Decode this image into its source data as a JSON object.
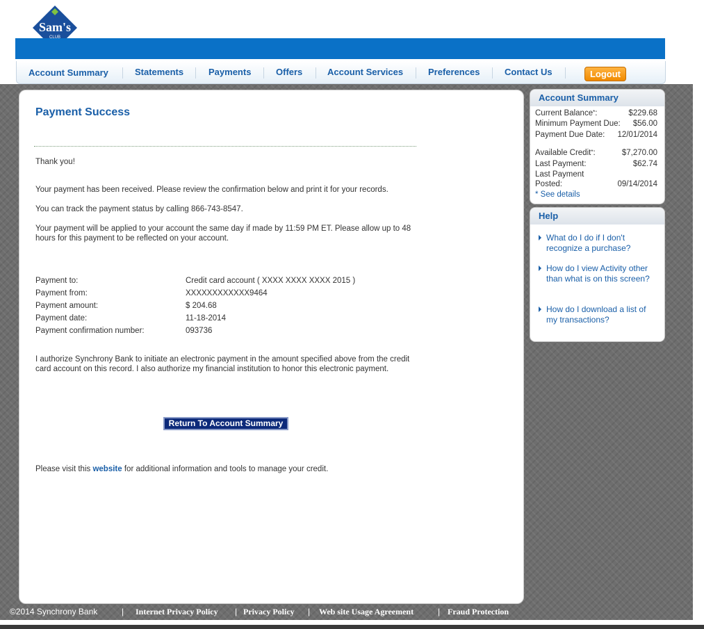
{
  "brand": {
    "logo_line1": "Sam's",
    "logo_line2": "CLUB"
  },
  "nav": {
    "items": [
      "Account Summary",
      "Statements",
      "Payments",
      "Offers",
      "Account Services",
      "Preferences",
      "Contact Us"
    ],
    "logout": "Logout"
  },
  "main": {
    "title": "Payment Success",
    "thank_you": "Thank you!",
    "received": "Your payment has been received. Please review the confirmation below and print it for your records.",
    "track": "You can track the payment status by calling 866-743-8547.",
    "applied": "Your payment will be applied to your account the same day if made by 11:59 PM ET. Please allow up to 48 hours for this payment to be reflected on your account.",
    "details": [
      {
        "label": "Payment to:",
        "value": "Credit card account ( XXXX XXXX XXXX 2015 )"
      },
      {
        "label": "Payment from:",
        "value": "XXXXXXXXXXXX9464"
      },
      {
        "label": "Payment amount:",
        "value": "$ 204.68"
      },
      {
        "label": "Payment date:",
        "value": "11-18-2014"
      },
      {
        "label": "Payment confirmation number:",
        "value": "093736"
      }
    ],
    "authorize": "I authorize Synchrony Bank to initiate an electronic payment in the amount specified above from the credit card account on this record. I also authorize my financial institution to honor this electronic payment.",
    "return_button": "Return To Account Summary",
    "visit_prefix": "Please visit this",
    "visit_link": "website",
    "visit_suffix": "for additional information and tools to manage your credit."
  },
  "summary": {
    "title": "Account Summary",
    "current_balance_label": "Current Balance",
    "current_balance": "$229.68",
    "asterisk": "*",
    "min_payment_label": "Minimum Payment Due:",
    "min_payment": "$56.00",
    "due_date_label": "Payment Due Date:",
    "due_date": "12/01/2014",
    "available_credit_label": "Available Credit",
    "available_credit": "$7,270.00",
    "last_payment_label": "Last Payment:",
    "last_payment": "$62.74",
    "last_posted_label1": "Last Payment",
    "last_posted_label2": "Posted:",
    "last_posted": "09/14/2014",
    "see_details": "* See details"
  },
  "help": {
    "title": "Help",
    "items": [
      "What do I do if I don't recognize a purchase?",
      "How do I view Activity other than what is on this screen?",
      "How do I download a list of my transactions?"
    ]
  },
  "footer": {
    "copyright": "©2014 Synchrony Bank",
    "sep": "|",
    "links": [
      "Internet Privacy Policy",
      "Privacy Policy",
      "Web site Usage Agreement",
      "Fraud Protection"
    ]
  }
}
